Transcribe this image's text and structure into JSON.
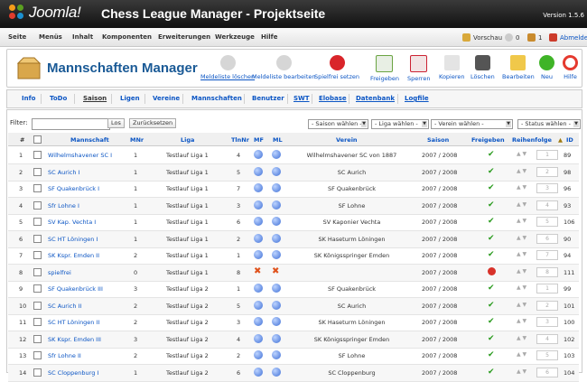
{
  "header": {
    "logo_text": "Joomla!",
    "title": "Chess League Manager - Projektseite",
    "version": "Version 1.5.6"
  },
  "menubar": {
    "items": [
      "Seite",
      "Menüs",
      "Inhalt",
      "Komponenten",
      "Erweiterungen",
      "Werkzeuge",
      "Hilfe"
    ],
    "preview": "Vorschau",
    "messages": "0",
    "users": "1",
    "logout": "Abmelden"
  },
  "toolbar": {
    "title": "Mannschaften Manager",
    "buttons": [
      "Meldeliste löschen",
      "Meldeliste bearbeiten",
      "Spielfrei setzen",
      "Freigeben",
      "Sperren",
      "Kopieren",
      "Löschen",
      "Bearbeiten",
      "Neu",
      "Hilfe"
    ]
  },
  "subnav": {
    "items": [
      "Info",
      "ToDo",
      "Saison",
      "Ligen",
      "Vereine",
      "Mannschaften",
      "Benutzer",
      "SWT",
      "Elobase",
      "Datenbank",
      "Logfile"
    ]
  },
  "filter": {
    "label": "Filter:",
    "go": "Los",
    "reset": "Zurücksetzen",
    "value": ""
  },
  "selects": {
    "saison": "- Saison wählen -",
    "liga": "- Liga wählen -",
    "verein": "- Verein wählen -",
    "status": "- Status wählen -"
  },
  "table": {
    "headers": {
      "num": "#",
      "mannschaft": "Mannschaft",
      "mnr": "MNr",
      "liga": "Liga",
      "tlnnr": "TlnNr",
      "mf": "MF",
      "ml": "ML",
      "verein": "Verein",
      "saison": "Saison",
      "freigegeben": "Freigeben",
      "reihenfolge": "Reihenfolge",
      "id": "ID"
    },
    "rows": [
      {
        "num": "1",
        "mannschaft": "Wilhelmshavener SC I",
        "mnr": "1",
        "liga": "Testlauf Liga 1",
        "tlnnr": "4",
        "verein": "Wilhelmshavener SC von 1887",
        "saison": "2007 / 2008",
        "ord": "1",
        "id": "89",
        "ok": true
      },
      {
        "num": "2",
        "mannschaft": "SC Aurich I",
        "mnr": "1",
        "liga": "Testlauf Liga 1",
        "tlnnr": "5",
        "verein": "SC Aurich",
        "saison": "2007 / 2008",
        "ord": "2",
        "id": "98",
        "ok": true
      },
      {
        "num": "3",
        "mannschaft": "SF Quakenbrück I",
        "mnr": "1",
        "liga": "Testlauf Liga 1",
        "tlnnr": "7",
        "verein": "SF Quakenbrück",
        "saison": "2007 / 2008",
        "ord": "3",
        "id": "96",
        "ok": true
      },
      {
        "num": "4",
        "mannschaft": "Sfr Lohne I",
        "mnr": "1",
        "liga": "Testlauf Liga 1",
        "tlnnr": "3",
        "verein": "SF Lohne",
        "saison": "2007 / 2008",
        "ord": "4",
        "id": "93",
        "ok": true
      },
      {
        "num": "5",
        "mannschaft": "SV Kap. Vechta I",
        "mnr": "1",
        "liga": "Testlauf Liga 1",
        "tlnnr": "6",
        "verein": "SV Kaponier Vechta",
        "saison": "2007 / 2008",
        "ord": "5",
        "id": "106",
        "ok": true
      },
      {
        "num": "6",
        "mannschaft": "SC HT Löningen I",
        "mnr": "1",
        "liga": "Testlauf Liga 1",
        "tlnnr": "2",
        "verein": "SK Haseturm Löningen",
        "saison": "2007 / 2008",
        "ord": "6",
        "id": "90",
        "ok": true
      },
      {
        "num": "7",
        "mannschaft": "SK Kspr. Emden II",
        "mnr": "2",
        "liga": "Testlauf Liga 1",
        "tlnnr": "1",
        "verein": "SK Königsspringer Emden",
        "saison": "2007 / 2008",
        "ord": "7",
        "id": "94",
        "ok": true
      },
      {
        "num": "8",
        "mannschaft": "spielfrei",
        "mnr": "0",
        "liga": "Testlauf Liga 1",
        "tlnnr": "8",
        "verein": "",
        "saison": "2007 / 2008",
        "ord": "8",
        "id": "111",
        "ok": false
      },
      {
        "num": "9",
        "mannschaft": "SF Quakenbrück III",
        "mnr": "3",
        "liga": "Testlauf Liga 2",
        "tlnnr": "1",
        "verein": "SF Quakenbrück",
        "saison": "2007 / 2008",
        "ord": "1",
        "id": "99",
        "ok": true
      },
      {
        "num": "10",
        "mannschaft": "SC Aurich II",
        "mnr": "2",
        "liga": "Testlauf Liga 2",
        "tlnnr": "5",
        "verein": "SC Aurich",
        "saison": "2007 / 2008",
        "ord": "2",
        "id": "101",
        "ok": true
      },
      {
        "num": "11",
        "mannschaft": "SC HT Löningen II",
        "mnr": "2",
        "liga": "Testlauf Liga 2",
        "tlnnr": "3",
        "verein": "SK Haseturm Löningen",
        "saison": "2007 / 2008",
        "ord": "3",
        "id": "100",
        "ok": true
      },
      {
        "num": "12",
        "mannschaft": "SK Kspr. Emden III",
        "mnr": "3",
        "liga": "Testlauf Liga 2",
        "tlnnr": "4",
        "verein": "SK Königsspringer Emden",
        "saison": "2007 / 2008",
        "ord": "4",
        "id": "102",
        "ok": true
      },
      {
        "num": "13",
        "mannschaft": "Sfr Lohne II",
        "mnr": "2",
        "liga": "Testlauf Liga 2",
        "tlnnr": "2",
        "verein": "SF Lohne",
        "saison": "2007 / 2008",
        "ord": "5",
        "id": "103",
        "ok": true
      },
      {
        "num": "14",
        "mannschaft": "SC Cloppenburg I",
        "mnr": "1",
        "liga": "Testlauf Liga 2",
        "tlnnr": "6",
        "verein": "SC Cloppenburg",
        "saison": "2007 / 2008",
        "ord": "6",
        "id": "104",
        "ok": true
      }
    ]
  },
  "colors": {
    "link": "#0b55c4",
    "title": "#1a5a96",
    "check": "#2a9b1e",
    "cross": "#e0521c"
  }
}
